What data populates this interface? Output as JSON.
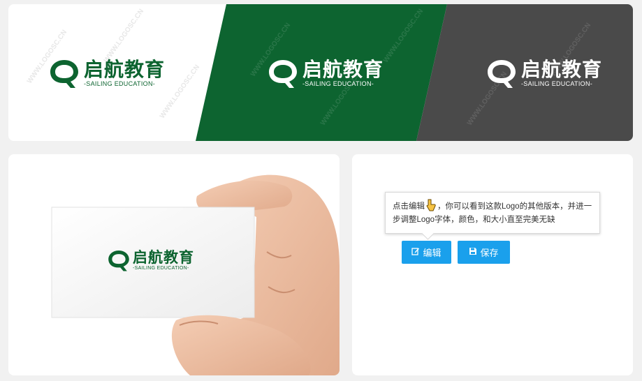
{
  "brand": {
    "name_cn": "启航教育",
    "name_en": "-SAILING EDUCATION-"
  },
  "watermark": "WWW.LOGOSC.CN",
  "colors": {
    "green": "#0d6430",
    "dark": "#4a4a4a",
    "white": "#ffffff",
    "button_blue": "#1aa0ec"
  },
  "tooltip": {
    "text_before": "点击编辑",
    "text_after": "，你可以看到这款Logo的其他版本，并进一步调整Logo字体，颜色，和大小直至完美无缺"
  },
  "buttons": {
    "edit_label": "编辑",
    "save_label": "保存"
  },
  "icons": {
    "edit": "edit-icon",
    "save": "save-icon",
    "pointer": "pointing-hand-icon"
  }
}
